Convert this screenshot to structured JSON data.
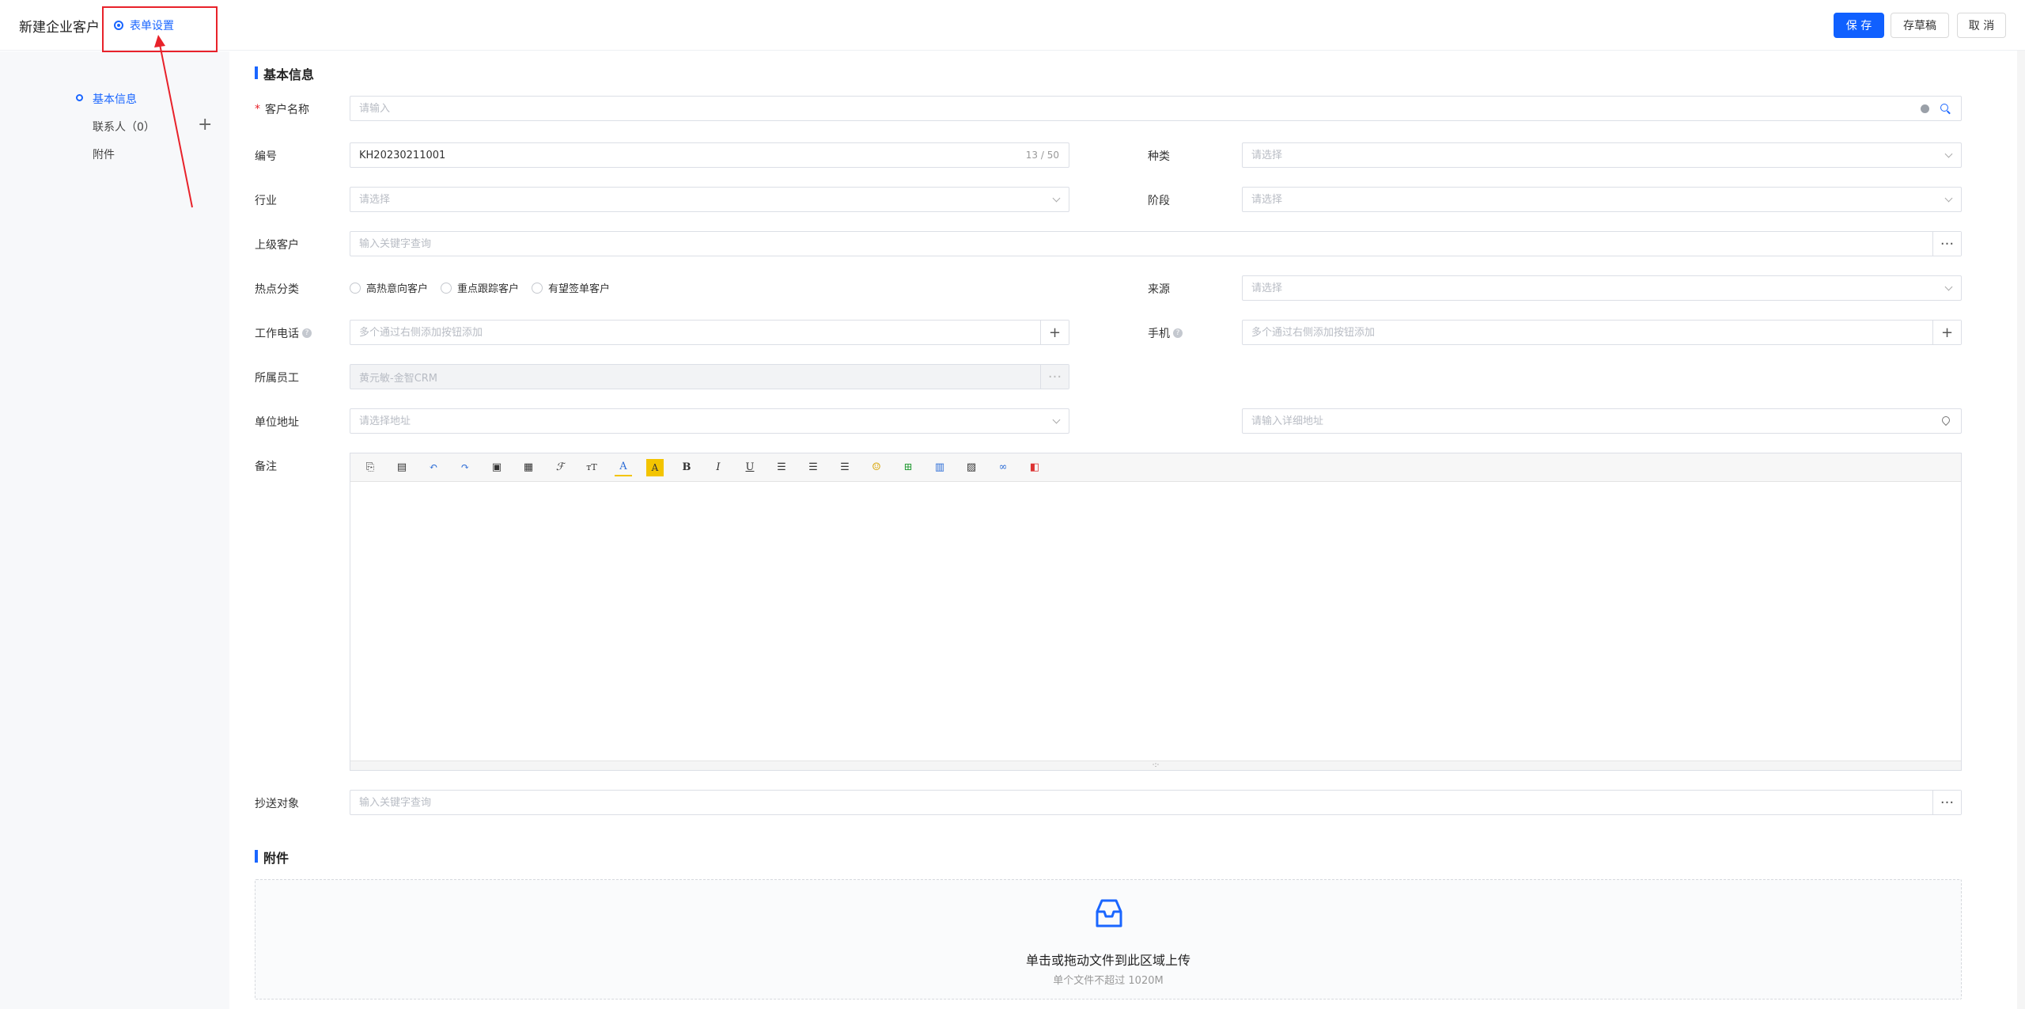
{
  "header": {
    "title": "新建企业客户",
    "form_settings": "表单设置",
    "save": "保 存",
    "draft": "存草稿",
    "cancel": "取 消"
  },
  "sidebar": {
    "items": [
      {
        "label": "基本信息"
      },
      {
        "label": "联系人（0）"
      },
      {
        "label": "附件"
      }
    ],
    "add_symbol": "+"
  },
  "sections": {
    "basic": "基本信息",
    "attachment": "附件"
  },
  "form": {
    "customer_name": {
      "label": "客户名称",
      "placeholder": "请输入"
    },
    "code": {
      "label": "编号",
      "value": "KH20230211001",
      "counter": "13 / 50"
    },
    "category": {
      "label": "种类",
      "placeholder": "请选择"
    },
    "industry": {
      "label": "行业",
      "placeholder": "请选择"
    },
    "stage": {
      "label": "阶段",
      "placeholder": "请选择"
    },
    "parent": {
      "label": "上级客户",
      "placeholder": "输入关键字查询"
    },
    "hot": {
      "label": "热点分类",
      "options": [
        "高热意向客户",
        "重点跟踪客户",
        "有望签单客户"
      ]
    },
    "source": {
      "label": "来源",
      "placeholder": "请选择"
    },
    "work_phone": {
      "label": "工作电话",
      "placeholder": "多个通过右侧添加按钮添加"
    },
    "mobile": {
      "label": "手机",
      "placeholder": "多个通过右侧添加按钮添加"
    },
    "owner": {
      "label": "所属员工",
      "value": "黄元敏-金智CRM"
    },
    "address": {
      "label": "单位地址",
      "placeholder": "请选择地址",
      "detail_placeholder": "请输入详细地址"
    },
    "remark": {
      "label": "备注"
    },
    "cc": {
      "label": "抄送对象",
      "placeholder": "输入关键字查询"
    }
  },
  "upload": {
    "text": "单击或拖动文件到此区域上传",
    "hint": "单个文件不超过 1020M"
  },
  "colors": {
    "primary": "#1060ff",
    "annotation": "#e8222a"
  }
}
